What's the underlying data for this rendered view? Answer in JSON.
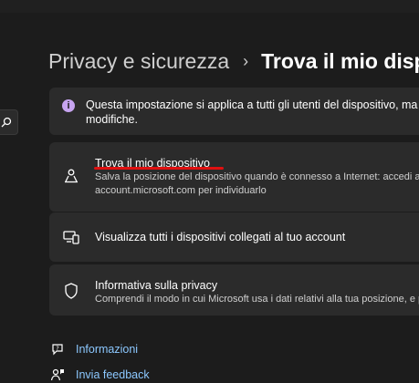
{
  "breadcrumb": {
    "parent": "Privacy e sicurezza",
    "separator": "›",
    "current": "Trova il mio disp"
  },
  "info": {
    "icon": "info-icon",
    "text": "Questa impostazione si applica a tutti gli utenti del dispositivo, ma solo se possiedono un account amministratore. Per ulteriori informazioni su come modificare",
    "text_line1": "Questa impostazione si applica a tutti gli utenti del dispositivo, ma so",
    "text_line2": "modifiche."
  },
  "settings": [
    {
      "icon": "person-location-icon",
      "title": "Trova il mio dispositivo",
      "subtitle_line1": "Salva la posizione del dispositivo quando è connesso a Internet: accedi ad",
      "subtitle_line2": "account.microsoft.com per individuarlo"
    },
    {
      "icon": "devices-icon",
      "title": "Visualizza tutti i dispositivi collegati al tuo account"
    },
    {
      "icon": "shield-icon",
      "title": "Informativa sulla privacy",
      "subtitle_line1": "Comprendi il modo in cui Microsoft usa i dati relativi alla tua posizione, e per"
    }
  ],
  "links": [
    {
      "icon": "help-icon",
      "label": "Informazioni"
    },
    {
      "icon": "feedback-icon",
      "label": "Invia feedback"
    }
  ],
  "colors": {
    "background": "#1c1c1c",
    "card": "#2b2b2b",
    "link": "#8cc8ff",
    "info_accent": "#c7a4f0",
    "annotation_red": "#e01010"
  }
}
